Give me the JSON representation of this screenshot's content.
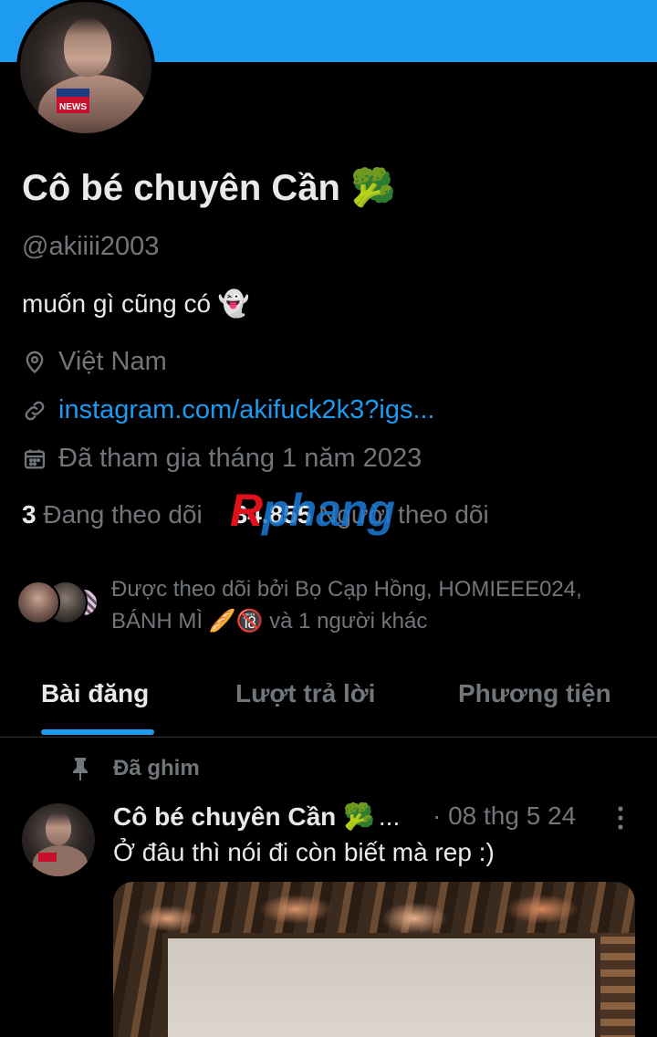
{
  "profile": {
    "display_name": "Cô bé chuyên Cần 🥦",
    "handle": "@akiiii2003",
    "bio": "muốn gì cũng có 👻",
    "location": "Việt Nam",
    "website": "instagram.com/akifuck2k3?igs...",
    "joined": "Đã tham gia tháng 1 năm 2023",
    "avatar_badge": "NEWS",
    "banner_color": "#1d9bf0"
  },
  "stats": {
    "following_count": "3",
    "following_label": "Đang theo dõi",
    "followers_count": "34.855",
    "followers_label": "Người theo dõi"
  },
  "watermark": {
    "first": "R",
    "rest": "phang"
  },
  "followed_by": {
    "text": "Được theo dõi bởi Bọ Cạp Hồng, HOMIEEE024, BÁNH MÌ 🥖🔞 và 1 người khác"
  },
  "tabs": [
    {
      "label": "Bài đăng",
      "active": true
    },
    {
      "label": "Lượt trả lời",
      "active": false
    },
    {
      "label": "Phương tiện",
      "active": false
    }
  ],
  "pinned_post": {
    "pinned_label": "Đã ghim",
    "author": "Cô bé chuyên Cần 🥦",
    "truncation": "...",
    "date": "· 08 thg 5 24",
    "text": "Ở đâu thì nói đi còn biết mà rep :)"
  },
  "colors": {
    "accent": "#1d9bf0",
    "background": "#000000",
    "text_primary": "#e7e9ea",
    "text_secondary": "#71767b"
  },
  "icons": {
    "location": "map-pin-icon",
    "website": "link-icon",
    "joined": "calendar-icon",
    "pinned": "pin-icon",
    "more": "more-vertical-icon"
  }
}
